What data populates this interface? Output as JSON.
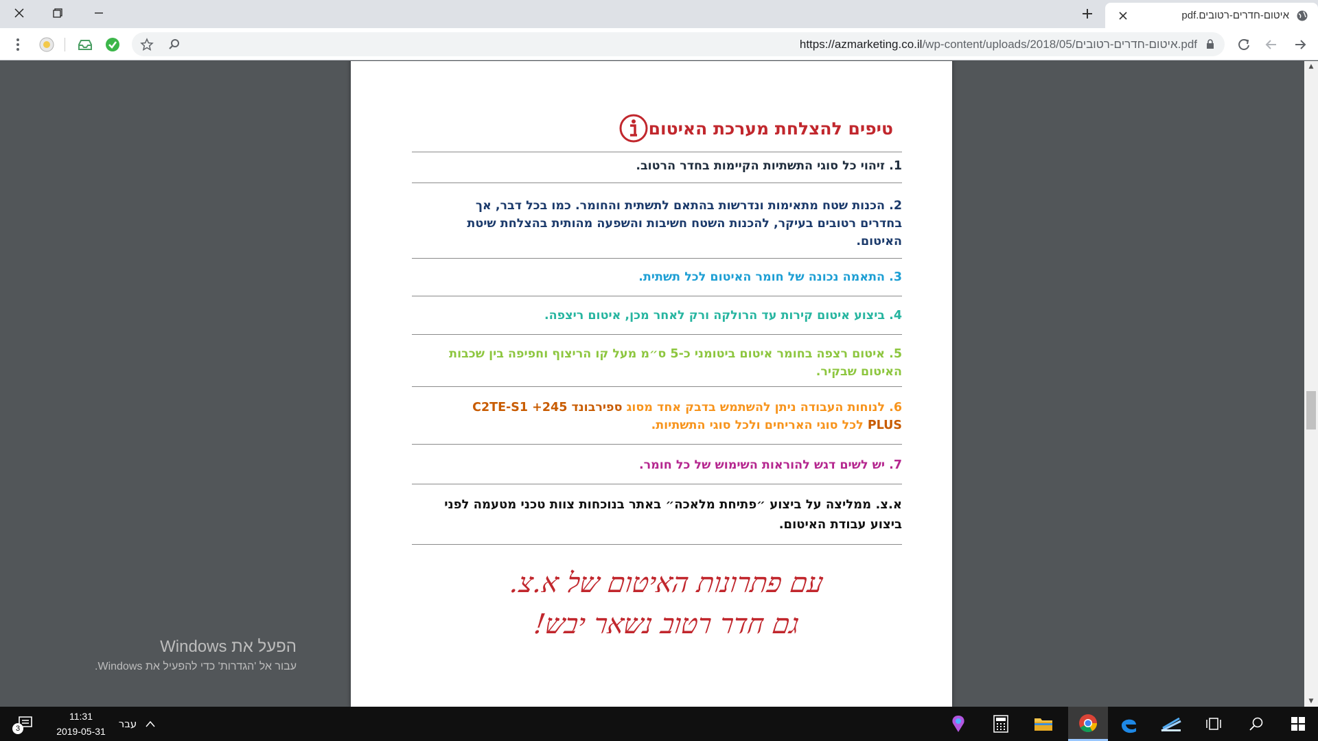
{
  "browser": {
    "tab_title": "איטום-חדרים-רטובים.pdf",
    "url_host": "https://azmarketing.co.il",
    "url_path": "/wp-content/uploads/2018/05/איטום-חדרים-רטובים.pdf",
    "icons": [
      "globe-icon",
      "close-icon",
      "new-tab-icon",
      "minimize-icon",
      "restore-icon",
      "back-icon",
      "forward-icon",
      "reload-icon",
      "lock-icon",
      "search-icon",
      "bookmark-star-icon",
      "extension-icons",
      "menu-icon"
    ]
  },
  "document": {
    "title": "טיפים להצלחת מערכת האיטום",
    "tips": [
      {
        "num": "1.",
        "text": "זיהוי כל סוגי התשתיות הקיימות בחדר הרטוב.",
        "color": "#1f2d3d"
      },
      {
        "num": "2.",
        "text": "הכנות שטח מתאימות ונדרשות בהתאם לתשתית והחומר. כמו בכל דבר, אך בחדרים רטובים בעיקר, להכנות השטח חשיבות והשפעה מהותית בהצלחת שיטת האיטום.",
        "color": "#1b3a6b"
      },
      {
        "num": "3.",
        "text": "התאמה נכונה של חומר האיטום לכל תשתית.",
        "color": "#1e9fd4"
      },
      {
        "num": "4.",
        "text": "ביצוע איטום קירות עד הרולקה ורק לאחר מכן, איטום ריצפה.",
        "color": "#27b5a0"
      },
      {
        "num": "5.",
        "text": "איטום רצפה בחומר איטום ביטומני כ-5 ס״מ מעל קו הריצוף וחפיפה בין שכבות האיטום שבקיר.",
        "color": "#8dc63f"
      },
      {
        "num": "6.",
        "text_before": "לנוחות העבודה ניתן להשתמש בדבק אחד מסוג",
        "brand": "ספירבונד 245+ C2TE-S1 PLUS",
        "text_after": "לכל סוגי האריחים ולכל סוגי התשתיות.",
        "color": "#f7941d"
      },
      {
        "num": "7.",
        "text": "יש לשים דגש להוראות השימוש של כל חומר.",
        "color": "#b5278f"
      }
    ],
    "recommendation": "א.צ. ממליצה על ביצוע ״פתיחת מלאכה״ באתר בנוכחות צוות טכני מטעמה לפני ביצוע עבודת האיטום.",
    "signature_line1": "עם פתרונות האיטום של א.צ.",
    "signature_line2": "גם חדר רטוב נשאר יבש!"
  },
  "watermark": {
    "line1": "הפעל את Windows",
    "line2": "עבור אל 'הגדרות' כדי להפעיל את Windows."
  },
  "taskbar": {
    "time": "11:31",
    "date": "2019-05-31",
    "language": "עבר",
    "notification_count": "3"
  }
}
